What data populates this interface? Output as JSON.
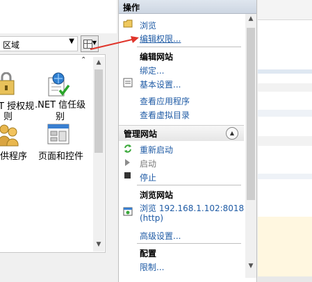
{
  "left_pane": {
    "group_combo": {
      "value": "区域"
    },
    "features": [
      {
        "label_line1": "T 授权规",
        "label_line2": "则",
        "icon": "lock-folder-icon"
      },
      {
        "label_line1": ".NET 信任级",
        "label_line2": "别",
        "icon": "dotnet-trust-icon"
      },
      {
        "label_line1": "供程序",
        "label_line2": "",
        "icon": "providers-icon"
      },
      {
        "label_line1": "页面和控件",
        "label_line2": "",
        "icon": "pages-controls-icon"
      }
    ]
  },
  "actions": {
    "header": "操作",
    "browse": "浏览",
    "edit_permissions": "编辑权限...",
    "edit_site": {
      "title": "编辑网站",
      "bindings": "绑定...",
      "basic_settings": "基本设置...",
      "view_applications": "查看应用程序",
      "view_virtual_dirs": "查看虚拟目录"
    },
    "manage_site": {
      "title": "管理网站",
      "restart": "重新启动",
      "start": "启动",
      "stop": "停止"
    },
    "browse_site": {
      "title": "浏览网站",
      "url_line1": "浏览 192.168.1.102:8018",
      "url_line2": "(http)",
      "advanced_settings": "高级设置..."
    },
    "config": {
      "title": "配置",
      "limits": "限制..."
    }
  },
  "colors": {
    "link": "#1f5ba5",
    "annotation_arrow": "#e0352b",
    "restart_icon": "#3aa83a",
    "stop_icon": "#333333"
  }
}
